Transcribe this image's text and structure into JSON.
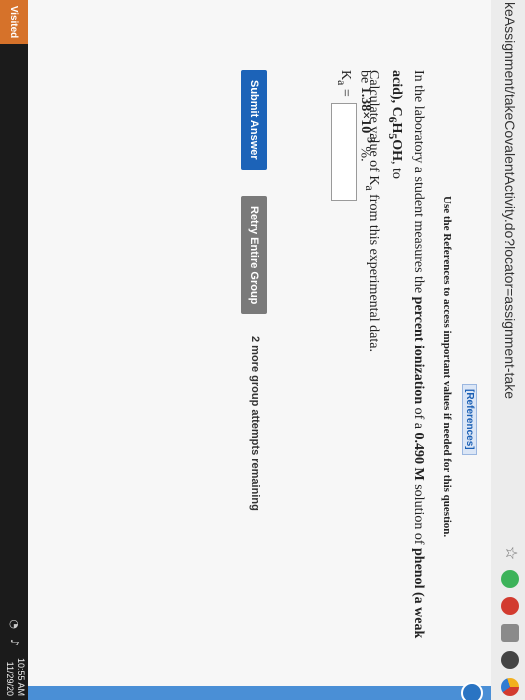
{
  "browser": {
    "address_text": "keAssignment/takeCovalentActivity.do?locator=assignment-take",
    "icons": [
      "star-icon",
      "green-extension-icon",
      "red-extension-icon",
      "puzzle-icon",
      "profile-icon",
      "multicolor-extension-icon"
    ]
  },
  "page": {
    "references_label": "[References]",
    "references_note": "Use the References to access important values if needed for this question.",
    "question_line1_a": "In the laboratory a student measures the ",
    "question_line1_bold1": "percent ionization",
    "question_line1_b": " of a ",
    "question_line1_bold2": "0.490 M",
    "question_line1_c": " solution of ",
    "question_line1_bold3": "phenol (a weak acid)",
    "question_line1_d": ", C",
    "formula_sub1": "6",
    "formula_h": "H",
    "formula_sub2": "5",
    "formula_end": "OH",
    "question_line1_e": ", to",
    "question_line2_a": "be ",
    "question_value": "1.38×10",
    "question_exp": "-3",
    "question_unit": " %.",
    "calc_text_a": "Calculate value of K",
    "calc_text_sub": "a",
    "calc_text_b": " from this experimental data.",
    "ka_label": "K",
    "ka_sub": "a",
    "ka_eq": " =",
    "ka_value": "",
    "submit_label": "Submit Answer",
    "retry_label": "Retry Entire Group",
    "attempts_text": "2 more group attempts remaining",
    "collapse_glyph": "<"
  },
  "taskbar": {
    "visited_label": "Visited",
    "time": "10:55 AM",
    "date": "11/29/20"
  },
  "colors": {
    "submit": "#1c63b8",
    "retry": "#7a7a7a",
    "references": "#1a5fb4",
    "visited": "#d6722a"
  }
}
